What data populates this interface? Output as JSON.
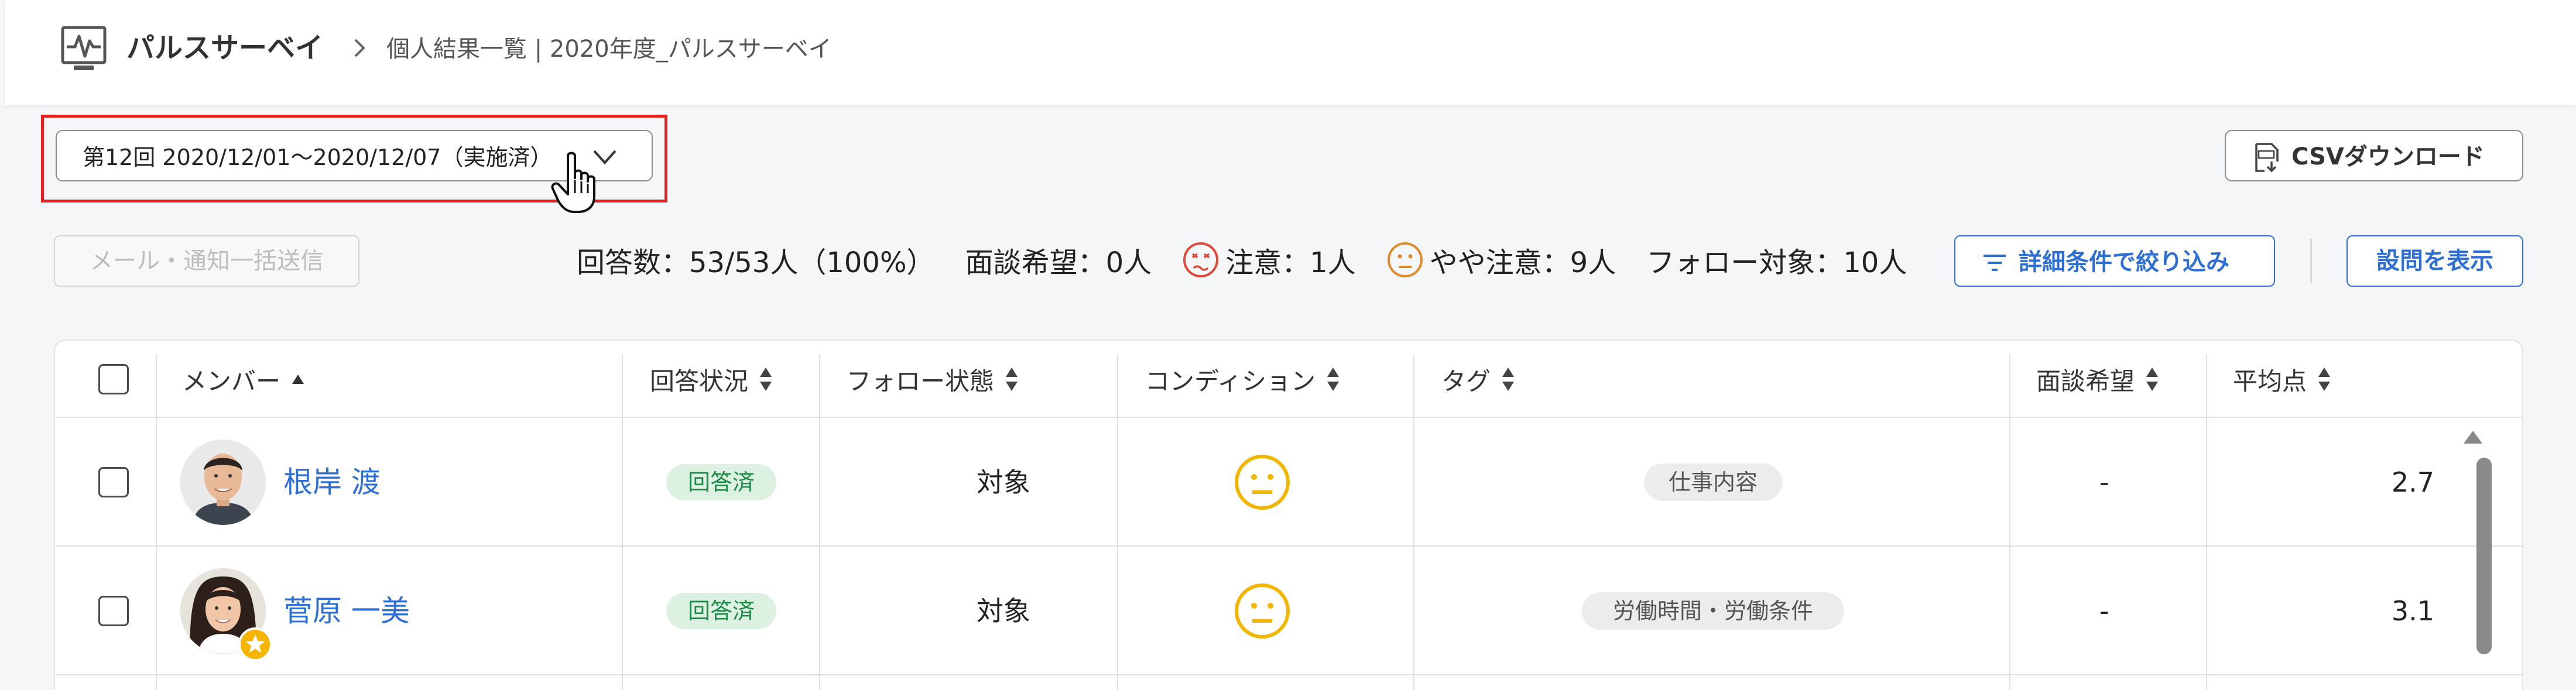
{
  "header": {
    "app_title": "パルスサーベイ",
    "breadcrumb": "個人結果一覧 | 2020年度_パルスサーベイ",
    "app_icon": "pulse-monitor-icon"
  },
  "round_select": {
    "value": "第12回 2020/12/01〜2020/12/07（実施済）",
    "highlight_color": "#e52222"
  },
  "csv_button": {
    "label": "CSVダウンロード",
    "icon": "csv-download-icon"
  },
  "toolbar": {
    "mail_button": "メール・通知一括送信",
    "responses": "回答数：53/53人（100%）",
    "interview_wish": "面談希望：0人",
    "caution": "注意：1人",
    "slight_caution": "やや注意：9人",
    "follow_target": "フォロー対象：10人",
    "filter_button": "詳細条件で絞り込み",
    "questions_button": "設問を表示"
  },
  "table": {
    "columns": {
      "member": "メンバー",
      "answer_status": "回答状況",
      "follow_status": "フォロー状態",
      "condition": "コンディション",
      "tag": "タグ",
      "interview": "面談希望",
      "average": "平均点"
    },
    "rows": [
      {
        "name": "根岸 渡",
        "answer_status": "回答済",
        "follow_status": "対象",
        "condition": "slightly-caution-face",
        "tag": "仕事内容",
        "interview": "-",
        "average": "2.7",
        "starred": false
      },
      {
        "name": "菅原 一美",
        "answer_status": "回答済",
        "follow_status": "対象",
        "condition": "slightly-caution-face",
        "tag": "労働時間・労働条件",
        "interview": "-",
        "average": "3.1",
        "starred": true
      }
    ]
  },
  "colors": {
    "accent_blue": "#2e6fd6",
    "caution_red": "#e0483a",
    "slight_caution_orange": "#e08a2c",
    "condition_yellow": "#f2b600",
    "answered_green": "#1e8a45"
  }
}
